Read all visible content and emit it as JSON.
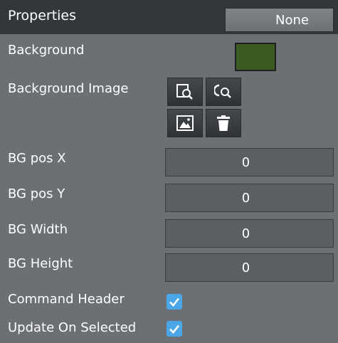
{
  "header": {
    "title": "Properties",
    "mode_button": "None"
  },
  "background": {
    "label": "Background",
    "color": "#3d5a23"
  },
  "background_image": {
    "label": "Background Image",
    "buttons": [
      "browse-image-icon",
      "search-image-icon",
      "image-preview-icon",
      "trash-icon"
    ]
  },
  "fields": [
    {
      "label": "BG pos X",
      "value": "0"
    },
    {
      "label": "BG pos Y",
      "value": "0"
    },
    {
      "label": "BG Width",
      "value": "0"
    },
    {
      "label": "BG Height",
      "value": "0"
    }
  ],
  "checkboxes": [
    {
      "label": "Command Header",
      "checked": true
    },
    {
      "label": "Update On Selected",
      "checked": true
    }
  ],
  "colors": {
    "accent": "#4aa6e6",
    "panel": "#6c6f73",
    "header": "#34373a"
  }
}
